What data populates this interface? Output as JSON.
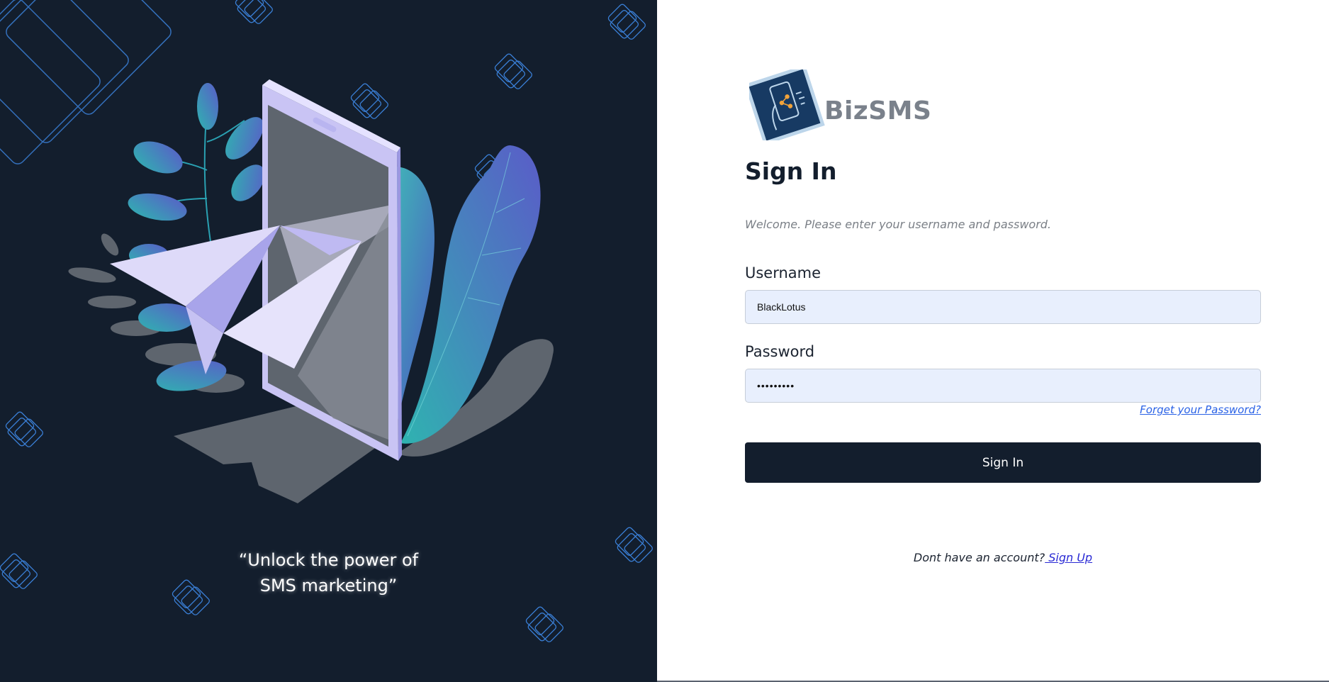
{
  "brand": {
    "name": "BizSMS",
    "logo_icon": "phone-share-icon"
  },
  "hero": {
    "tagline_line1": "“Unlock the power of",
    "tagline_line2": "SMS marketing”",
    "illustration": "paper-plane-phone-illustration"
  },
  "form": {
    "heading": "Sign In",
    "welcome": "Welcome. Please enter your username and password.",
    "username_label": "Username",
    "username_value": "BlackLotus",
    "password_label": "Password",
    "password_value": "BlackLoto",
    "forgot_link": "Forget your Password?",
    "submit_label": "Sign In",
    "signup_prompt": "Dont have an account?",
    "signup_link": " Sign Up"
  },
  "colors": {
    "navy": "#131e2d",
    "input_bg": "#e8effd",
    "link_blue": "#2a62e6",
    "teal": "#2fb3b0",
    "violet": "#5a5cc8"
  }
}
